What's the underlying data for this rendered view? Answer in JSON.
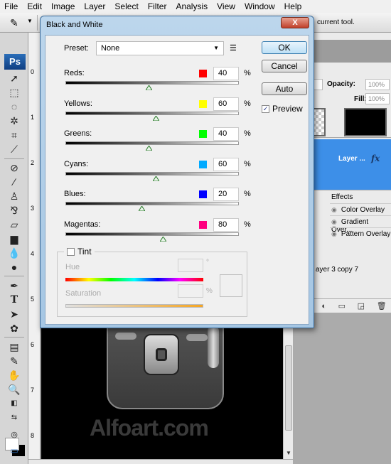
{
  "menubar": [
    "File",
    "Edit",
    "Image",
    "Layer",
    "Select",
    "Filter",
    "Analysis",
    "View",
    "Window",
    "Help"
  ],
  "options_bar": {
    "tool_icon": "eyedropper-icon",
    "hint": "current tool."
  },
  "toolbox": {
    "logo": "Ps",
    "tools": [
      "move-icon",
      "marquee-icon",
      "lasso-icon",
      "magic-wand-icon",
      "crop-icon",
      "slice-icon",
      "healing-brush-icon",
      "brush-icon",
      "clone-stamp-icon",
      "history-brush-icon",
      "eraser-icon",
      "gradient-icon",
      "blur-icon",
      "dodge-icon",
      "pen-icon",
      "type-icon",
      "path-selection-icon",
      "custom-shape-icon",
      "notes-icon",
      "eyedropper-icon",
      "hand-icon",
      "zoom-icon"
    ]
  },
  "ruler": {
    "labels": [
      "0",
      "1",
      "2",
      "3",
      "4",
      "5",
      "6",
      "7",
      "8"
    ]
  },
  "canvas": {
    "watermark": "Alfoart.com"
  },
  "layers_panel": {
    "opacity_label": "Opacity:",
    "opacity_value": "100%",
    "fill_label": "Fill:",
    "fill_value": "100%",
    "selected_layer_name": "Layer ...",
    "fx_label": "fx",
    "effects_label": "Effects",
    "effects": [
      "Color Overlay",
      "Gradient Over...",
      "Pattern Overlay"
    ],
    "other_layer": "ayer 3 copy 7"
  },
  "dialog": {
    "title": "Black and White",
    "close_label": "X",
    "preset_label": "Preset:",
    "preset_value": "None",
    "buttons": {
      "ok": "OK",
      "cancel": "Cancel",
      "auto": "Auto"
    },
    "preview_label": "Preview",
    "preview_checked": true,
    "slider_range": [
      -200,
      300
    ],
    "channels": [
      {
        "label": "Reds:",
        "value": "40",
        "color": "#ff0000"
      },
      {
        "label": "Yellows:",
        "value": "60",
        "color": "#ffff00"
      },
      {
        "label": "Greens:",
        "value": "40",
        "color": "#00ff00"
      },
      {
        "label": "Cyans:",
        "value": "60",
        "color": "#00aaff"
      },
      {
        "label": "Blues:",
        "value": "20",
        "color": "#0000ff"
      },
      {
        "label": "Magentas:",
        "value": "80",
        "color": "#ff0080"
      }
    ],
    "percent": "%",
    "tint": {
      "label": "Tint",
      "checked": false,
      "hue_label": "Hue",
      "hue_unit": "°",
      "saturation_label": "Saturation",
      "saturation_unit": "%"
    }
  }
}
